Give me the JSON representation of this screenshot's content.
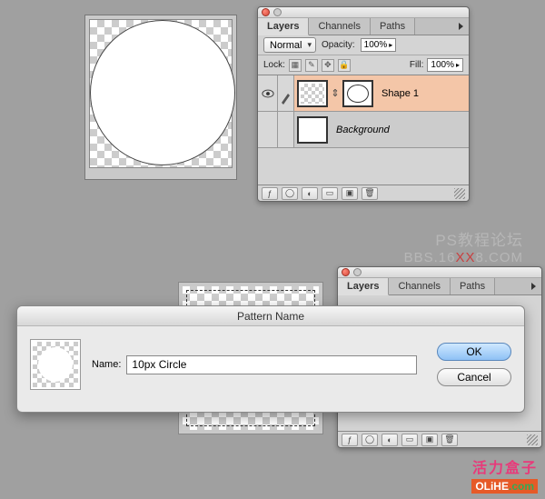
{
  "canvas": {
    "shape": "circle"
  },
  "palette1": {
    "tabs": {
      "layers": "Layers",
      "channels": "Channels",
      "paths": "Paths"
    },
    "blend_mode": "Normal",
    "opacity_label": "Opacity:",
    "opacity_value": "100%",
    "lock_label": "Lock:",
    "fill_label": "Fill:",
    "fill_value": "100%",
    "layers": [
      {
        "name": "Shape 1",
        "selected": true
      },
      {
        "name": "Background",
        "selected": false
      }
    ]
  },
  "palette2": {
    "tabs": {
      "layers": "Layers",
      "channels": "Channels",
      "paths": "Paths"
    }
  },
  "dialog": {
    "title": "Pattern Name",
    "name_label": "Name:",
    "name_value": "10px Circle",
    "ok": "OK",
    "cancel": "Cancel"
  },
  "watermark": {
    "line1": "PS教程论坛",
    "line2_a": "BBS.16",
    "line2_b": "XX",
    "line2_c": "8.COM"
  },
  "brand1": "活力盒子",
  "brand2_a": "OLiHE",
  "brand2_b": ".com"
}
